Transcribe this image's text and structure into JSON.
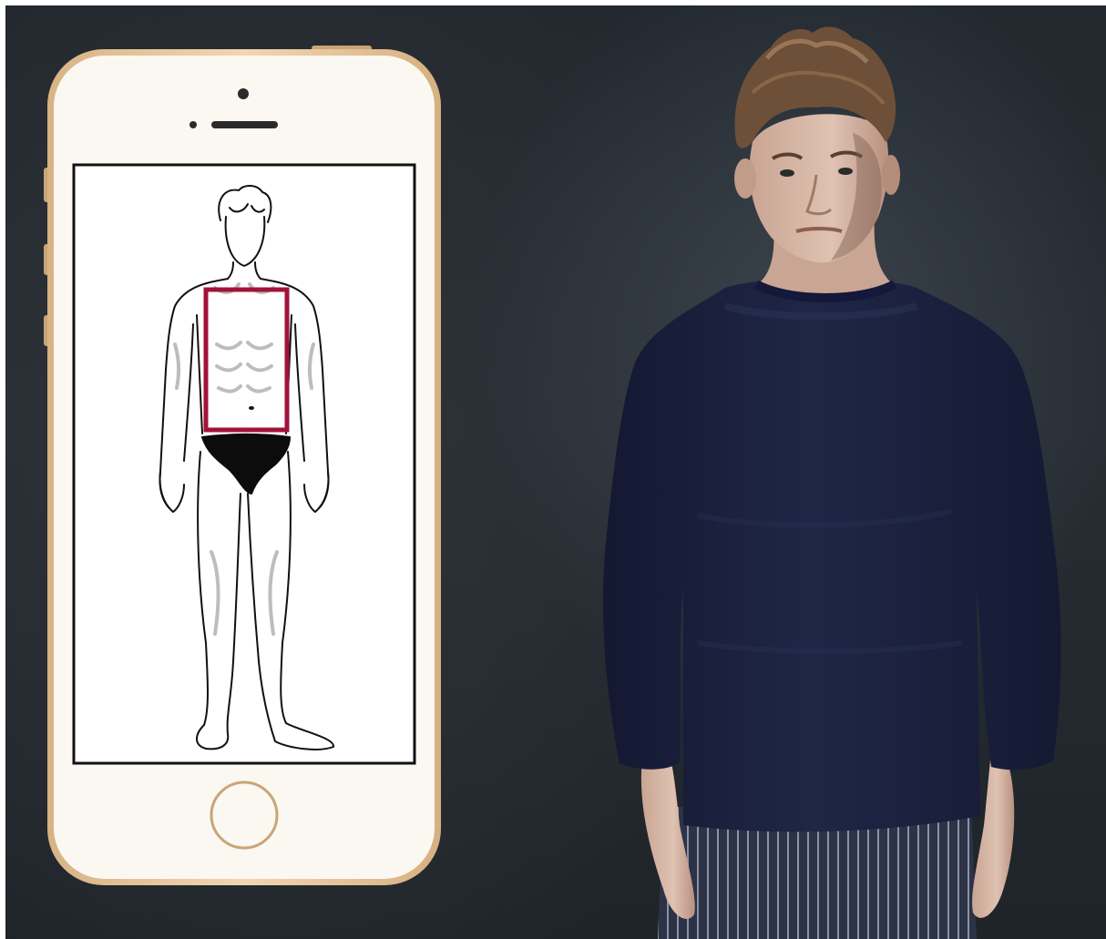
{
  "scene": {
    "description_icon": "phone-body-shape-icon",
    "colors": {
      "background": "#262c32",
      "phone_frame": "#ebc9a0",
      "phone_body": "#fbf8f2",
      "screen": "#ffffff",
      "body_outline": "#1a1a1a",
      "highlight_box": "#a3123a",
      "underwear": "#0c0c0c",
      "sweater": "#1b2140",
      "trousers": "#2d3447",
      "skin": "#d8b8a6",
      "hair": "#7a5a3e"
    }
  }
}
